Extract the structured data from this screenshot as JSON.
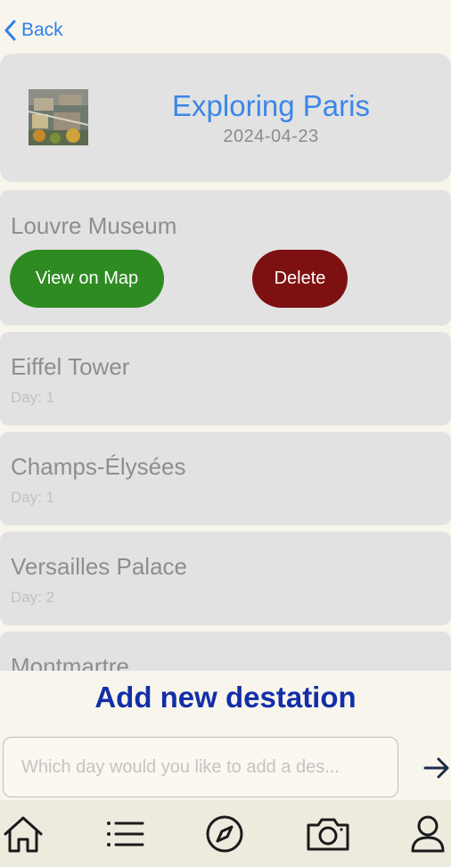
{
  "nav": {
    "back_label": "Back"
  },
  "trip": {
    "title": "Exploring Paris",
    "date": "2024-04-23"
  },
  "destinations": [
    {
      "name": "Louvre Museum",
      "expanded": true,
      "map_label": "View on Map",
      "delete_label": "Delete"
    },
    {
      "name": "Eiffel Tower",
      "day": "Day: 1"
    },
    {
      "name": "Champs-Élysées",
      "day": "Day: 1"
    },
    {
      "name": "Versailles Palace",
      "day": "Day: 2"
    },
    {
      "name": "Montmartre"
    }
  ],
  "add": {
    "heading": "Add new destation",
    "placeholder": "Which day would you like to add a des..."
  },
  "tabs": [
    "home-icon",
    "list-icon",
    "compass-icon",
    "camera-icon",
    "profile-icon"
  ],
  "colors": {
    "background": "#f8f6ec",
    "card": "#e2e2e2",
    "accent_blue": "#3b86e8",
    "heading_blue": "#132ea8",
    "map_button": "#2e8b22",
    "delete_button": "#7d1010"
  }
}
